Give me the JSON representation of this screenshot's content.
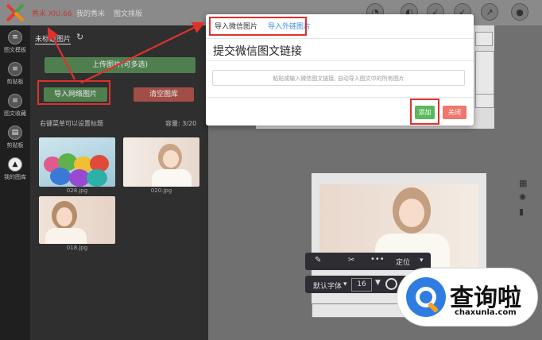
{
  "topbar": {
    "brand": "秀米 XIU.66",
    "nav": [
      "我的秀米",
      "图文排版"
    ]
  },
  "siderail": {
    "items": [
      {
        "label": "图文模板",
        "icon": "list-icon"
      },
      {
        "label": "剪贴板",
        "icon": "list-icon"
      },
      {
        "label": "图文收藏",
        "icon": "list-icon"
      },
      {
        "label": "剪贴板",
        "icon": "clipboard-icon"
      },
      {
        "label": "我的图库",
        "icon": "image-icon"
      }
    ]
  },
  "panel": {
    "tab_label": "未标题图片",
    "upload_button": "上传图片(可多选)",
    "import_button": "导入网络图片",
    "clear_button": "清空图库",
    "hint": "右键菜单可以设置标题",
    "capacity": "容量: 3/20",
    "thumbnails": [
      {
        "name": "028.jpg"
      },
      {
        "name": "020.jpg"
      },
      {
        "name": "018.jpg"
      }
    ]
  },
  "modal": {
    "tabs": [
      "导入微信图片",
      "导入外链图片"
    ],
    "title": "提交微信图文链接",
    "input_placeholder": "粘贴或输入微信图文链接, 自动导入图文中的所有图片",
    "add_button": "添加",
    "close_button": "关闭"
  },
  "toolbar": {
    "font_label": "默认字体",
    "font_size": "16",
    "position_label": "定位"
  },
  "watermark": {
    "text": "查询啦",
    "url": "chaxunla.com"
  },
  "colors": {
    "accent_red": "#e0312c",
    "green": "#5cb85c",
    "close_red": "#f0766e",
    "blue_tab": "#3a8ee6"
  }
}
